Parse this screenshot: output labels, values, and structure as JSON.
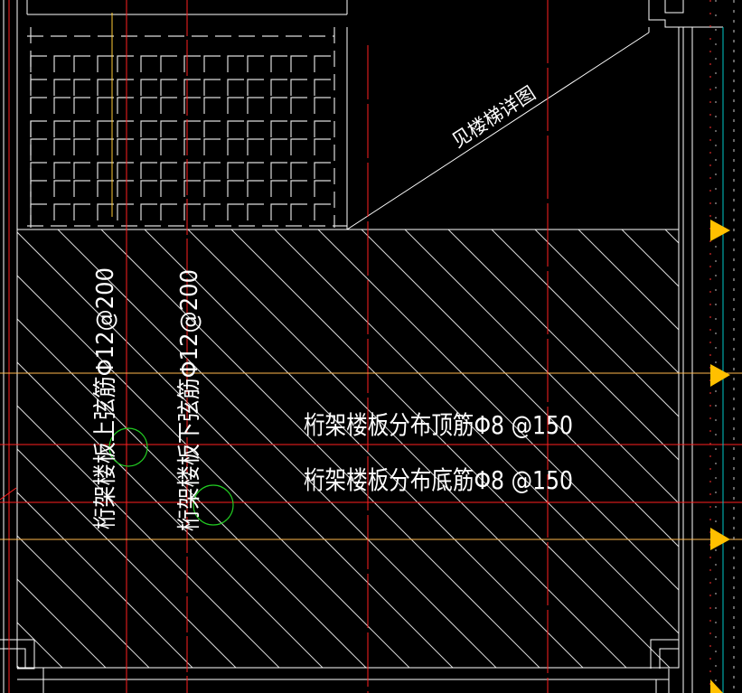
{
  "drawing": {
    "stair_note": "见楼梯详图",
    "top_chord_label": "桁架楼板上弦筋Φ12@200",
    "bottom_chord_label": "桁架楼板下弦筋Φ12@200",
    "top_distribution_label": "桁架楼板分布顶筋Φ8 @150",
    "bottom_distribution_label": "桁架楼板分布底筋Φ8 @150"
  },
  "colors": {
    "background": "#000000",
    "linework": "#ffffff",
    "axis_red": "#ff2020",
    "beam_orange": "#ffb84d",
    "circle_green": "#22cc22",
    "marker_yellow": "#ffc000",
    "right_line_cyan": "#00c8c8"
  }
}
